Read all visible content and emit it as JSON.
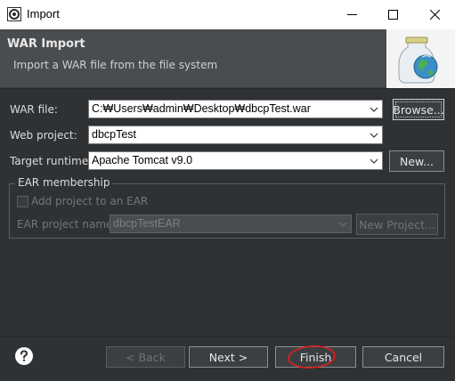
{
  "window": {
    "title": "Import",
    "minimize_icon": "minimize-icon",
    "maximize_icon": "maximize-icon",
    "close_icon": "close-icon"
  },
  "banner": {
    "heading": "WAR Import",
    "description": "Import a WAR file from the file system",
    "image_icon": "war-import-wizard-icon"
  },
  "form": {
    "war_file_label": "WAR file:",
    "war_file_value": "C:₩Users₩admin₩Desktop₩dbcpTest.war",
    "browse_label": "Browse...",
    "web_project_label": "Web project:",
    "web_project_value": "dbcpTest",
    "target_runtime_label": "Target runtime:",
    "target_runtime_value": "Apache Tomcat v9.0",
    "new_label": "New..."
  },
  "ear": {
    "group_title": "EAR membership",
    "add_project_label": "Add project to an EAR",
    "add_project_checked": false,
    "ear_project_name_label": "EAR project name:",
    "ear_project_name_value": "dbcpTestEAR",
    "new_project_label": "New Project..."
  },
  "footer": {
    "help_icon": "help-icon",
    "back_label": "< Back",
    "next_label": "Next >",
    "finish_label": "Finish",
    "cancel_label": "Cancel",
    "annotation_color": "#e0201c"
  },
  "colors": {
    "dialog_bg": "#2f3235",
    "banner_bg": "#4a4d50",
    "titlebar_bg": "#ffffff"
  }
}
